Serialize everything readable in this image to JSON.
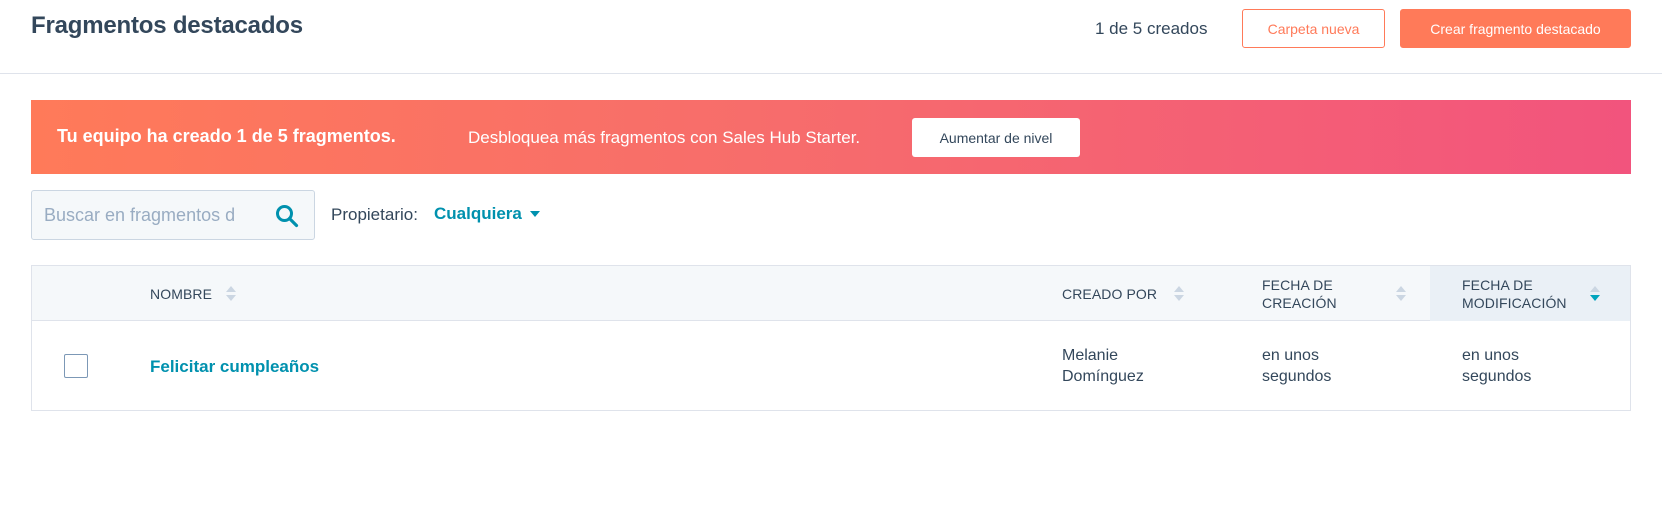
{
  "header": {
    "title": "Fragmentos destacados",
    "count_text": "1 de 5 creados",
    "new_folder_label": "Carpeta nueva",
    "create_label": "Crear fragmento destacado"
  },
  "banner": {
    "strong_text": "Tu equipo ha creado 1 de 5 fragmentos.",
    "text": "Desbloquea más fragmentos con Sales Hub Starter.",
    "button_label": "Aumentar de nivel"
  },
  "filters": {
    "search_placeholder": "Buscar en fragmentos d",
    "owner_label": "Propietario:",
    "owner_value": "Cualquiera"
  },
  "table": {
    "columns": {
      "name": "NOMBRE",
      "created_by": "CREADO POR",
      "created_date_line1": "FECHA DE",
      "created_date_line2": "CREACIÓN",
      "modified_date_line1": "FECHA DE",
      "modified_date_line2": "MODIFICACIÓN"
    },
    "rows": [
      {
        "name": "Felicitar cumpleaños",
        "created_by_line1": "Melanie",
        "created_by_line2": "Domínguez",
        "created_line1": "en unos",
        "created_line2": "segundos",
        "modified_line1": "en unos",
        "modified_line2": "segundos"
      }
    ]
  },
  "colors": {
    "accent": "#ff7a59",
    "link": "#0091ae",
    "text": "#33475b",
    "banner_gradient_end": "#f2547d"
  },
  "icons": {
    "search": "search-icon",
    "owner_caret": "caret-down-icon",
    "sort": "sort-icon"
  }
}
